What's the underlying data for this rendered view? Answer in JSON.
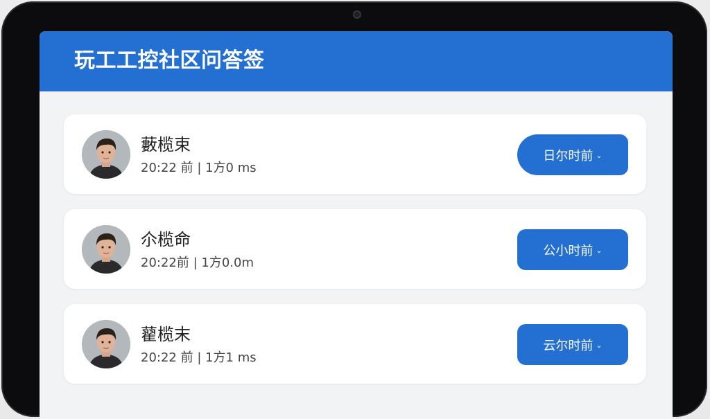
{
  "header": {
    "title": "玩工工控社区问答签"
  },
  "items": [
    {
      "name": "藪榄束",
      "meta": "20:22 前 | 1方0 ms",
      "time_button": "日尔时前",
      "chevron_icon": "chevron-down-icon",
      "avatar_icon": "user-avatar"
    },
    {
      "name": "尒榄命",
      "meta": "20:22前 | 1方0.0m",
      "time_button": "公小时前",
      "chevron_icon": "chevron-down-icon",
      "avatar_icon": "user-avatar"
    },
    {
      "name": "藋榄末",
      "meta": "20:22 前 | 1方1 ms",
      "time_button": "云尔时前",
      "chevron_icon": "chevron-down-icon",
      "avatar_icon": "user-avatar"
    }
  ],
  "colors": {
    "accent": "#2370d2",
    "background": "#f2f3f5",
    "card": "#ffffff",
    "bezel": "#0c0c0e"
  }
}
